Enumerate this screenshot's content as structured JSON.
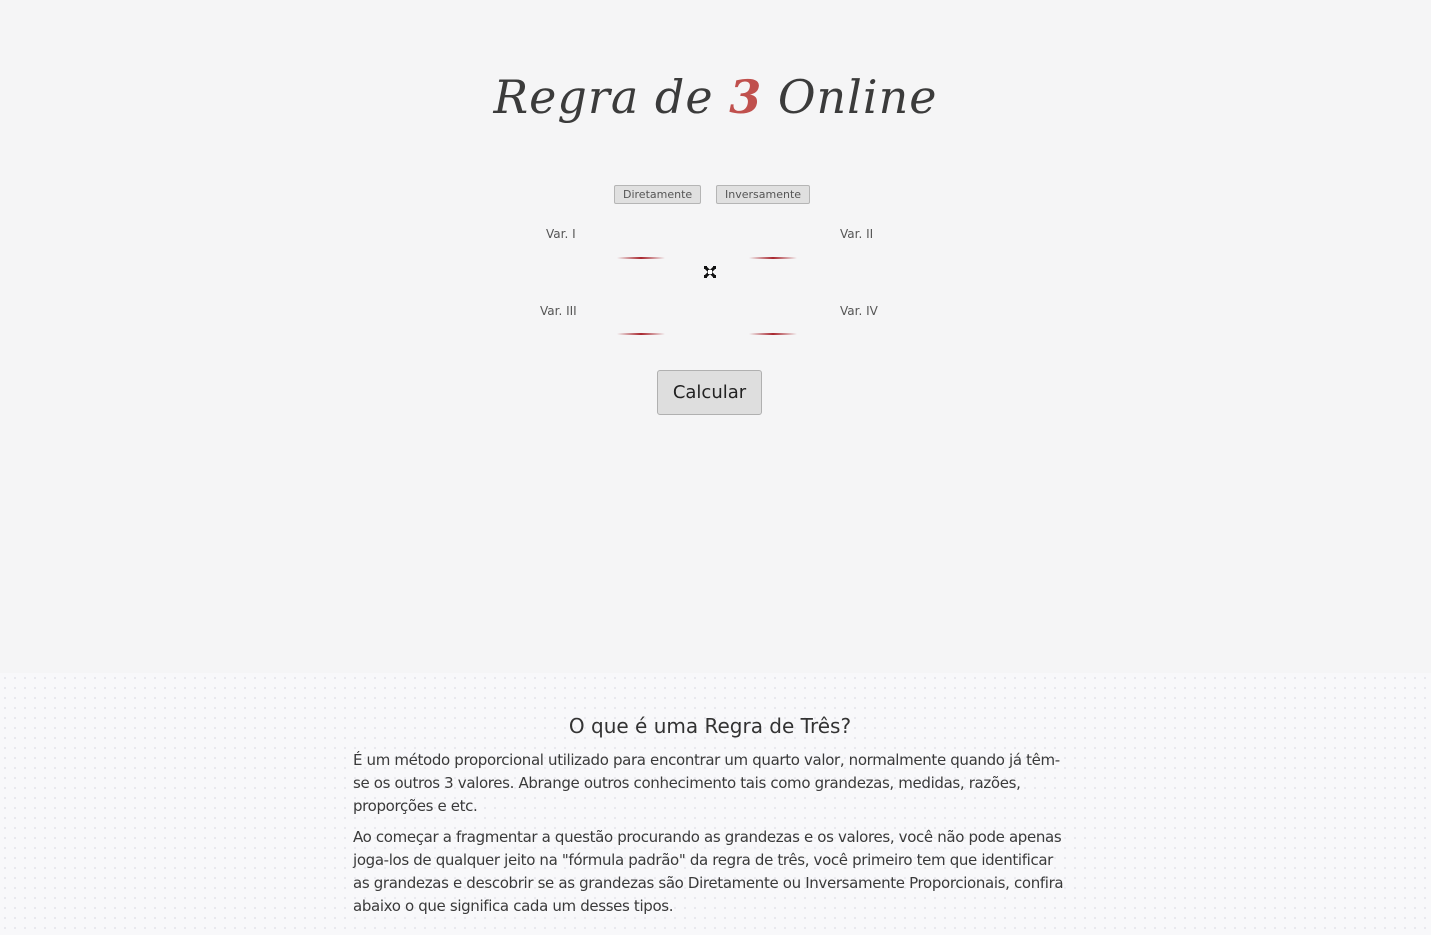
{
  "header": {
    "logo_prefix": "Regra de ",
    "logo_number": "3",
    "logo_suffix": " Online",
    "accent_color": "#c0504d"
  },
  "calculator": {
    "modes": [
      "Diretamente",
      "Inversamente"
    ],
    "labels": {
      "var1": "Var. I",
      "var2": "Var. II",
      "var3": "Var. III",
      "var4": "Var. IV"
    },
    "values": {
      "var1": "",
      "var2": "",
      "var3": "",
      "var4": ""
    },
    "operator_icon": "cross-icon",
    "calculate_label": "Calcular",
    "underline_color": "#a8262e"
  },
  "article": {
    "title": "O que é uma Regra de Três?",
    "paragraphs": [
      "É um método proporcional utilizado para encontrar um quarto valor, normalmente quando já têm-se os outros 3 valores. Abrange outros conhecimento tais como grandezas, medidas, razões, proporções e etc.",
      "Ao começar a fragmentar a questão procurando as grandezas e os valores, você não pode apenas joga-los de qualquer jeito na \"fórmula padrão\" da regra de três, você primeiro tem que identificar as grandezas e descobrir se as grandezas são Diretamente ou Inversamente Proporcionais, confira abaixo o que significa cada um desses tipos."
    ]
  }
}
